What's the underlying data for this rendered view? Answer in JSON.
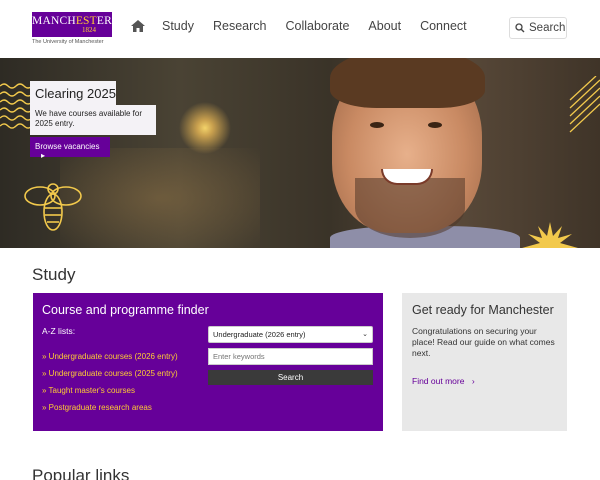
{
  "header": {
    "logo": {
      "word_a": "MANCH",
      "word_b": "EST",
      "word_c": "ER",
      "year": "1824",
      "subtitle": "The University of Manchester"
    },
    "nav": {
      "home_icon": "home-icon",
      "items": [
        "Study",
        "Research",
        "Collaborate",
        "About",
        "Connect"
      ]
    },
    "search": {
      "label": "Search",
      "icon": "search-icon"
    }
  },
  "hero": {
    "title": "Clearing 2025",
    "body": "We have courses available for 2025 entry.",
    "cta": "Browse vacancies"
  },
  "study": {
    "heading": "Study",
    "finder": {
      "title": "Course and programme finder",
      "az_label": "A-Z lists:",
      "links": [
        "» Undergraduate courses (2026 entry)",
        "» Undergraduate courses (2025 entry)",
        "» Taught master's courses",
        "» Postgraduate research areas"
      ],
      "select_value": "Undergraduate (2026 entry)",
      "keywords_placeholder": "Enter keywords",
      "search_label": "Search"
    },
    "ready": {
      "title": "Get ready for Manchester",
      "body": "Congratulations on securing your place! Read our guide on what comes next.",
      "link": "Find out more"
    }
  },
  "popular": {
    "heading": "Popular links"
  },
  "colors": {
    "brand_purple": "#660099",
    "brand_gold": "#ffcc33",
    "panel_grey": "#e8e8e8"
  }
}
